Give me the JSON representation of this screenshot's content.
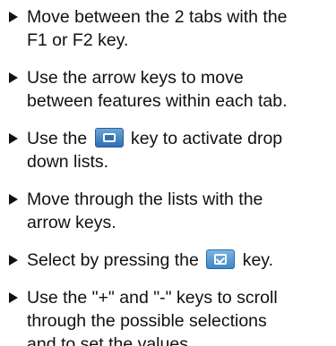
{
  "instructions": [
    {
      "line1": "Move between the 2 tabs with the",
      "line2": "F1 or F2 key."
    },
    {
      "line1": "Use the arrow keys to move",
      "line2": "between features within each tab."
    },
    {
      "before": "Use the",
      "after": "key to activate drop",
      "line2": "down lists.",
      "icon": "drop-list-key-icon"
    },
    {
      "line1": "Move through the lists with the",
      "line2": "arrow keys."
    },
    {
      "before": "Select by pressing the",
      "after": "key.",
      "icon": "select-check-key-icon"
    },
    {
      "line1": "Use the \"+\" and \"-\" keys to scroll",
      "line2": "through the possible selections",
      "line3": "and to set the values."
    }
  ],
  "colors": {
    "text": "#111111",
    "key_blue": "#2f6fb3"
  }
}
